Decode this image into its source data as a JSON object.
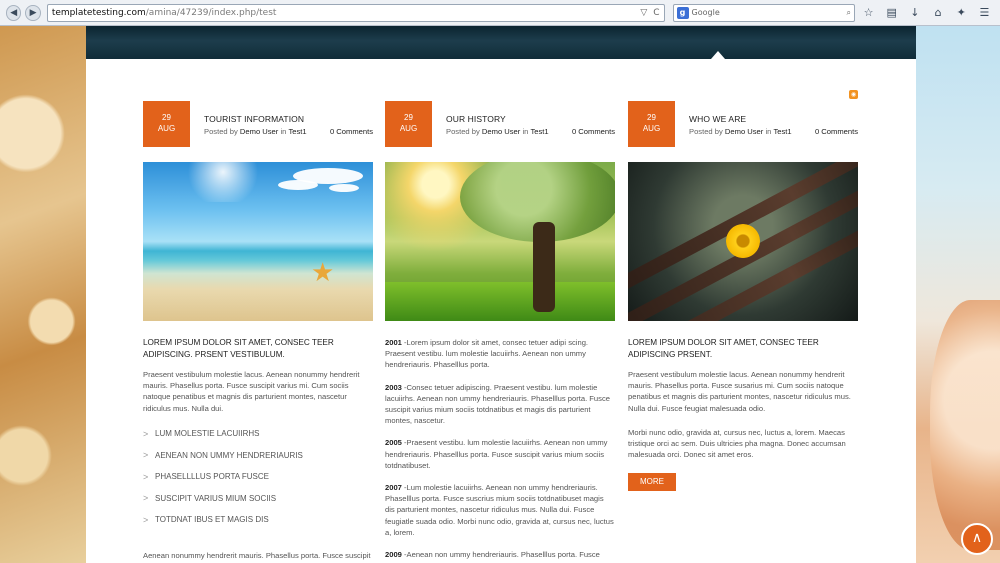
{
  "browser": {
    "url_host": "templatetesting.com",
    "url_path": "/amina/47239/index.php/test",
    "search_placeholder": "Google",
    "search_engine_glyph": "g",
    "back_glyph": "◀",
    "forward_glyph": "▶",
    "dropdown_glyph": "▽",
    "reload_glyph": "C",
    "search_glyph": "⌕",
    "star_glyph": "☆",
    "clipboard_glyph": "▤",
    "download_glyph": "↓",
    "home_glyph": "⌂",
    "addon_glyph": "✦",
    "menu_glyph": "☰"
  },
  "rss_glyph": "◉",
  "posts": [
    {
      "day": "29",
      "month": "AUG",
      "title": "TOURIST INFORMATION",
      "posted_by": "Posted by",
      "author": "Demo User",
      "in": "in",
      "category": "Test1",
      "comments": "0 Comments",
      "image": "beach-starfish",
      "lead": "LOREM IPSUM DOLOR SIT AMET, CONSEC TEER ADIPISCING. PRSENT VESTIBULUM.",
      "paragraph": "Praesent vestibulum molestie lacus. Aenean nonummy hendrerit mauris. Phasellus porta. Fusce suscipit varius mi. Cum sociis natoque penatibus et magnis dis parturient montes, nascetur ridiculus mus. Nulla dui.",
      "list_bullet": ">",
      "list": [
        "LUM MOLESTIE LACUIIRHS",
        "AENEAN NON UMMY HENDRERIAURIS",
        "PHASELLLLUS PORTA FUSCE",
        "SUSCIPIT VARIUS MIUM SOCIIS",
        "TOTDNAT IBUS ET MAGIS DIS"
      ],
      "tail": "Aenean nonummy hendrerit mauris. Phasellus porta. Fusce suscipit varius mi. Cum sociis natoque penatibus et magnis dis"
    },
    {
      "day": "29",
      "month": "AUG",
      "title": "OUR HISTORY",
      "posted_by": "Posted by",
      "author": "Demo User",
      "in": "in",
      "category": "Test1",
      "comments": "0 Comments",
      "image": "green-tree",
      "history": [
        {
          "year": "2001",
          "text": " -Lorem ipsum dolor sit amet, consec tetuer adipi scing. Praesent vestibu. lum molestie lacuiirhs. Aenean non ummy hendreriauris. Phaselllus porta."
        },
        {
          "year": "2003",
          "text": " -Consec tetuer adipiscing. Praesent vestibu. lum molestie lacuiirhs. Aenean non ummy hendreriauris. Phaselllus porta. Fusce suscipit varius mium sociis totdnatibus et magis dis parturient montes, nascetur."
        },
        {
          "year": "2005",
          "text": " -Praesent vestibu. lum molestie lacuiirhs. Aenean non ummy hendreriauris. Phaselllus porta. Fusce suscipit varius mium sociis totdnatibuset."
        },
        {
          "year": "2007",
          "text": " -Lum molestie lacuiirhs. Aenean non ummy hendreriauris. Phaselllus porta. Fusce suscrius mium sociis totdnatibuset magis dis parturient montes, nascetur ridiculus mus. Nulla dui. Fusce feugiatle suada odio. Morbi nunc odio, gravida at, cursus nec, luctus a, lorem."
        },
        {
          "year": "2009",
          "text": " -Aenean non ummy hendreriauris. Phaselllus porta. Fusce"
        }
      ]
    },
    {
      "day": "29",
      "month": "AUG",
      "title": "WHO WE ARE",
      "posted_by": "Posted by",
      "author": "Demo User",
      "in": "in",
      "category": "Test1",
      "comments": "0 Comments",
      "image": "bench-flower",
      "lead": "LOREM IPSUM DOLOR SIT AMET, CONSEC TEER ADIPISCING PRSENT.",
      "paragraph": "Praesent vestibulum molestie lacus. Aenean nonummy hendrerit mauris. Phasellus porta. Fusce susarius mi. Cum sociis natoque penatibus et magnis dis parturient montes, nascetur ridiculus mus. Nulla dui. Fusce feugiat malesuada odio.",
      "paragraph2": "Morbi nunc odio, gravida at, cursus nec, luctus a, lorem. Maecas tristique orci ac sem. Duis ultricies pha magna. Donec accumsan malesuada orci. Donec sit amet eros.",
      "more_label": "MORE"
    }
  ],
  "back_to_top_glyph": "∧",
  "colors": {
    "accent": "#e2621b"
  }
}
